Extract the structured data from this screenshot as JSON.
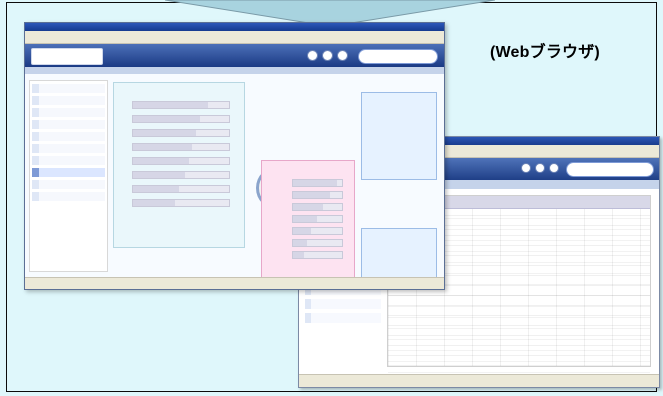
{
  "caption": {
    "text": "(Webブラウザ)"
  },
  "icons": {
    "arrow": "down-arrow-icon"
  }
}
